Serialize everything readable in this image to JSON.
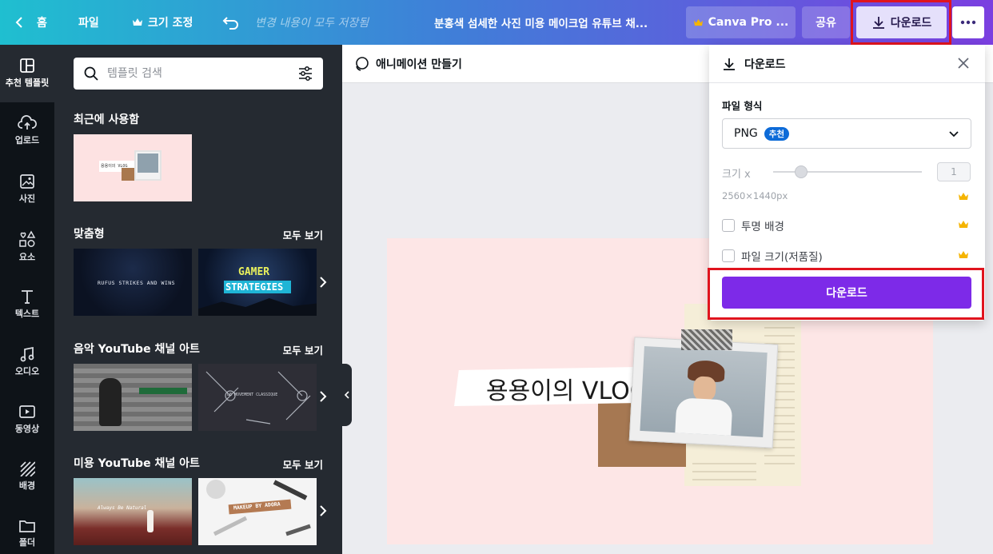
{
  "topbar": {
    "home": "홈",
    "file": "파일",
    "resize": "크기 조정",
    "saved_status": "변경 내용이 모두 저장됨",
    "doc_title": "분홍색 섬세한 사진 미용 메이크업 유튜브 채...",
    "canva_pro": "Canva Pro ...",
    "share": "공유",
    "download": "다운로드"
  },
  "rail": {
    "items": [
      {
        "label": "추천 템플릿"
      },
      {
        "label": "업로드"
      },
      {
        "label": "사진"
      },
      {
        "label": "요소"
      },
      {
        "label": "텍스트"
      },
      {
        "label": "오디오"
      },
      {
        "label": "동영상"
      },
      {
        "label": "배경"
      },
      {
        "label": "폴더"
      }
    ]
  },
  "panel": {
    "search_placeholder": "템플릿 검색",
    "recent_title": "최근에 사용함",
    "see_all": "모두 보기",
    "sections": [
      {
        "title": "맞춤형",
        "thumb_texts": [
          "RUFUS STRIKES AND WINS",
          "GAMER",
          "STRATEGIES"
        ]
      },
      {
        "title": "음악 YouTube 채널 아트",
        "thumb_texts": [
          "LE MOVEMENT CLASSIQUE"
        ]
      },
      {
        "title": "미용 YouTube 채널 아트",
        "thumb_texts": [
          "Always Be Natural",
          "MAKEUP BY ADORA"
        ]
      }
    ],
    "recent_thumb_text": "용용이의 VLOG"
  },
  "canvas": {
    "animate": "애니메이션 만들기",
    "artboard_title": "용용이의 VLOG"
  },
  "download_panel": {
    "title": "다운로드",
    "file_type_label": "파일 형식",
    "file_type_value": "PNG",
    "recommended_badge": "추천",
    "size_label": "크기 x",
    "size_value": "1",
    "dimensions": "2560×1440px",
    "transparent_bg": "투명 배경",
    "compress_file": "파일 크기(저품질)",
    "download_button": "다운로드"
  },
  "colors": {
    "accent_purple": "#7d2ae8",
    "highlight_red": "#e0141e",
    "badge_blue": "#0d6bd8",
    "crown_gold": "#f5b400"
  }
}
